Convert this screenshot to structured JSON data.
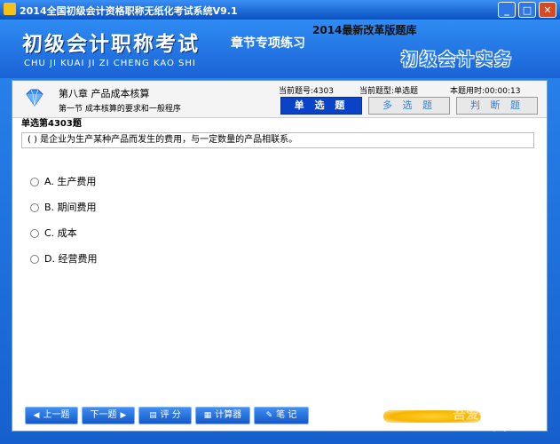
{
  "window": {
    "title": "2014全国初级会计资格职称无纸化考试系统V9.1",
    "buttons": {
      "minimize": "_",
      "maximize": "□",
      "close": "✕"
    }
  },
  "banner": {
    "main_title": "初级会计职称考试",
    "chapter_practice": "章节专项练习",
    "pinyin": "CHU JI KUAI JI ZI CHENG KAO SHI",
    "edition": "2014最新改革版题库",
    "subject": "初级会计实务"
  },
  "info": {
    "chapter": "第八章  产品成本核算",
    "section": "第一节  成本核算的要求和一般程序",
    "current_number": "当前题号:4303",
    "current_type": "当前题型:单选题",
    "time": "本题用时:00:00:13"
  },
  "tabs": [
    {
      "label": "单 选 题",
      "active": true
    },
    {
      "label": "多 选 题",
      "active": false
    },
    {
      "label": "判 断 题",
      "active": false
    }
  ],
  "question": {
    "type_label": "单选第4303题",
    "text": "( ) 是企业为生产某种产品而发生的费用，与一定数量的产品相联系。",
    "options": [
      "A. 生产费用",
      "B. 期间费用",
      "C. 成本",
      "D. 经营费用"
    ]
  },
  "bottom": {
    "prev": "上一题",
    "next": "下一题",
    "score": "评 分",
    "calculator": "计算器",
    "notes": "笔 记"
  },
  "watermark": {
    "text": "吾爱破解论坛",
    "url": "www.52pojie.cn"
  },
  "colors": {
    "window_blue": "#1c6fd8",
    "active_tab": "#0b43c8",
    "close_red": "#d9481f"
  }
}
